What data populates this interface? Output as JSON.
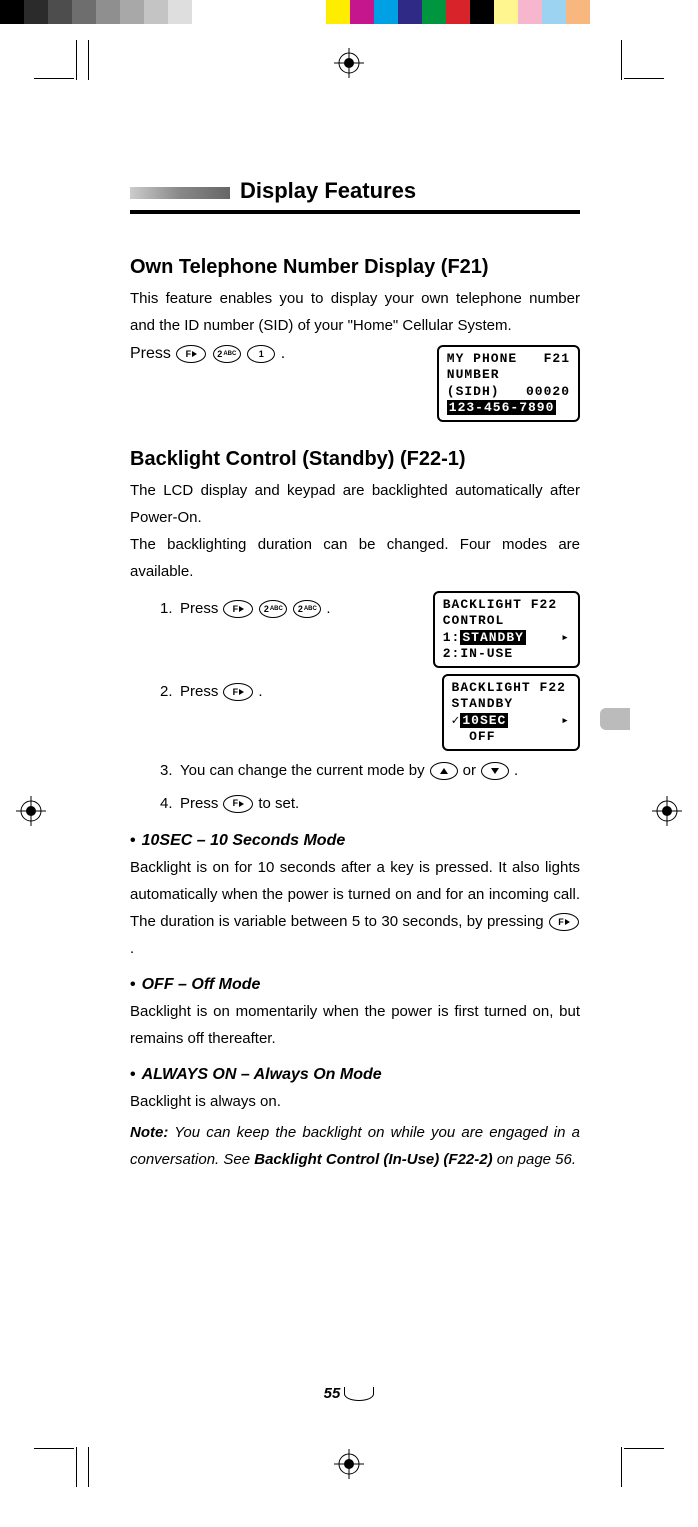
{
  "colorbar": [
    "#000",
    "#333",
    "#555",
    "#777",
    "#999",
    "#aaa",
    "#ccc",
    "#eee",
    "#fff",
    "#fff",
    "#fff",
    "#ff0",
    "#c0f",
    "#09f",
    "#00c",
    "#0a0",
    "#c00",
    "#000",
    "#ff8",
    "#fbd",
    "#8cf",
    "#fb8"
  ],
  "header": {
    "title": "Display Features"
  },
  "section1": {
    "title": "Own Telephone Number Display (F21)",
    "body": "This feature enables you to display your own telephone number and the ID number (SID) of your \"Home\" Cellular System.",
    "press": "Press",
    "period": " .",
    "lcd": {
      "l1": "MY PHONE   F21",
      "l2": "NUMBER",
      "l3": "(SIDH)   00020",
      "l4": "123-456-7890"
    }
  },
  "section2": {
    "title": "Backlight Control (Standby) (F22-1)",
    "body1": "The LCD display and keypad are backlighted automatically after Power-On.",
    "body2": "The backlighting duration can be changed. Four modes are available.",
    "steps": {
      "s1": {
        "num": "1.",
        "txt": "Press",
        "period": " ."
      },
      "s2": {
        "num": "2.",
        "txt": "Press",
        "period": " ."
      },
      "s3": {
        "num": "3.",
        "a": "You can change the current mode by ",
        "or": " or ",
        "period": " ."
      },
      "s4": {
        "num": "4.",
        "a": "Press ",
        "b": " to set."
      }
    },
    "lcd1": {
      "l1": "BACKLIGHT F22",
      "l2": "CONTROL",
      "l3a": "1:",
      "l3b": "STANDBY",
      "l4": "2:IN-USE"
    },
    "lcd2": {
      "l1": "BACKLIGHT F22",
      "l2": "STANDBY",
      "l3a": "✓",
      "l3b": "10SEC",
      "l4": "  OFF"
    }
  },
  "modes": {
    "m1": {
      "title": "10SEC – 10 Seconds Mode",
      "body_a": "Backlight is on for 10 seconds after a key is pressed. It also lights automatically when the power is turned on and for an incoming call.  The duration is variable between 5 to 30 seconds, by pressing ",
      "body_b": " ."
    },
    "m2": {
      "title": "OFF – Off Mode",
      "body": "Backlight is on momentarily when the power is first turned on, but remains off thereafter."
    },
    "m3": {
      "title": "ALWAYS ON – Always On Mode",
      "body": "Backlight is always on."
    }
  },
  "note": {
    "label": "Note:",
    "body_a": "  You can keep the backlight on while you are engaged in a conversation. See ",
    "bold": "Backlight Control (In-Use) (F22-2)",
    "body_b": " on page 56."
  },
  "keys": {
    "F": "F",
    "2abc": "2",
    "2abc_sup": "ABC",
    "1": "1"
  },
  "page": "55"
}
